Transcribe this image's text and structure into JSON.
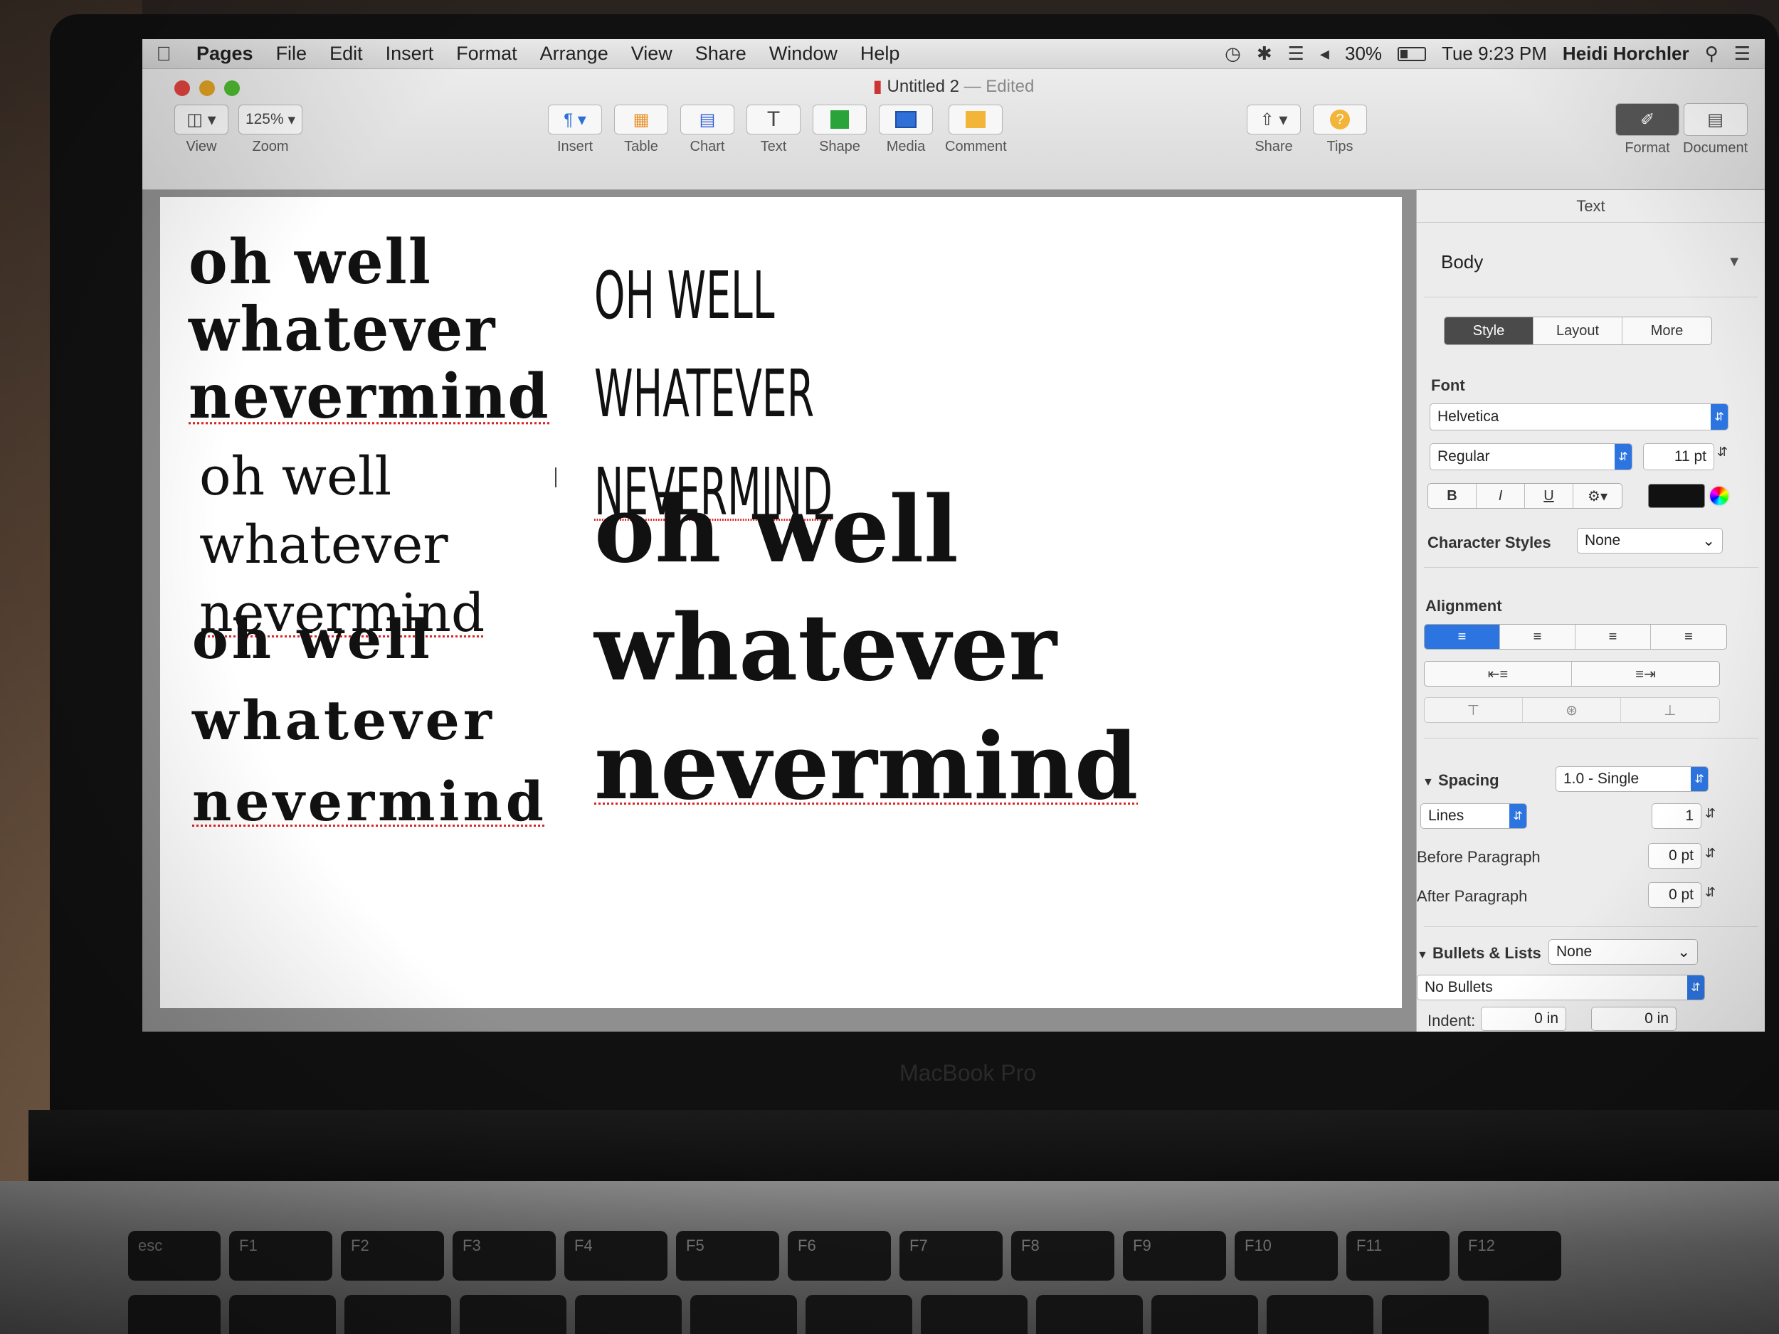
{
  "menubar": {
    "items": [
      "Pages",
      "File",
      "Edit",
      "Insert",
      "Format",
      "Arrange",
      "View",
      "Share",
      "Window",
      "Help"
    ],
    "battery": "30%",
    "clock": "Tue 9:23 PM",
    "user": "Heidi Horchler"
  },
  "window": {
    "title": "Untitled 2",
    "status": "— Edited",
    "zoom_value": "125%"
  },
  "toolbar": {
    "view_label": "View",
    "zoom_label": "Zoom",
    "insert_label": "Insert",
    "table_label": "Table",
    "chart_label": "Chart",
    "text_label": "Text",
    "text_glyph": "T",
    "shape_label": "Shape",
    "media_label": "Media",
    "comment_label": "Comment",
    "share_label": "Share",
    "tips_label": "Tips",
    "tips_glyph": "?",
    "format_label": "Format",
    "document_label": "Document"
  },
  "document": {
    "samples": [
      {
        "lines": [
          "oh well",
          "whatever",
          "nevermind"
        ]
      },
      {
        "lines": [
          "OH WELL",
          "WHATEVER",
          "NEVERMIND"
        ]
      },
      {
        "lines": [
          "oh well",
          "whatever",
          "nevermind"
        ]
      },
      {
        "lines": [
          "oh well",
          "whatever",
          "nevermind"
        ]
      },
      {
        "lines": [
          "oh well",
          "whatever",
          "nevermind"
        ]
      }
    ]
  },
  "inspector": {
    "header": "Text",
    "paragraph_style": "Body",
    "tabs": [
      "Style",
      "Layout",
      "More"
    ],
    "font_label": "Font",
    "font_family": "Helvetica",
    "font_typeface": "Regular",
    "font_size": "11 pt",
    "bold": "B",
    "italic": "I",
    "underline": "U",
    "character_styles_label": "Character Styles",
    "character_styles_value": "None",
    "alignment_label": "Alignment",
    "spacing_label": "Spacing",
    "spacing_value": "1.0 - Single",
    "lines_label": "Lines",
    "lines_value": "1",
    "before_paragraph_label": "Before Paragraph",
    "before_paragraph_value": "0 pt",
    "after_paragraph_label": "After Paragraph",
    "after_paragraph_value": "0 pt",
    "bullets_label": "Bullets & Lists",
    "bullets_value": "None",
    "bullets_style": "No Bullets",
    "indent_label": "Indent:",
    "indent_value_1": "0 in",
    "indent_value_2": "0 in"
  },
  "laptop": {
    "brand": "MacBook Pro",
    "keys": [
      "esc",
      "F1",
      "F2",
      "F3",
      "F4",
      "F5",
      "F6",
      "F7",
      "F8",
      "F9",
      "F10",
      "F11",
      "F12"
    ]
  }
}
